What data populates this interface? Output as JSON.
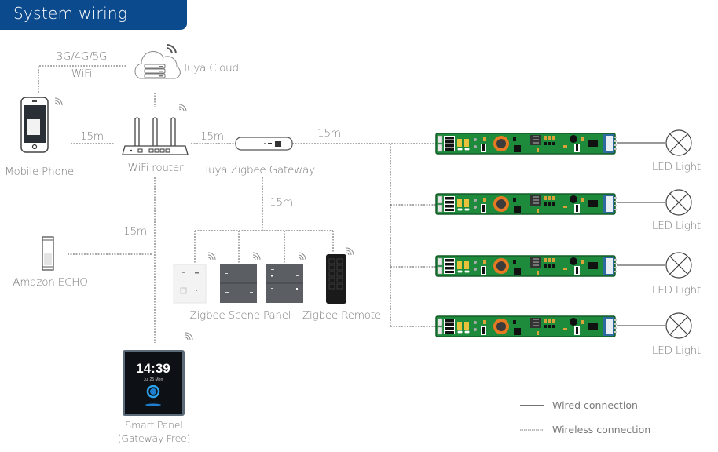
{
  "title": "System wiring",
  "colors": {
    "title_bg": "#0c4a8e",
    "title_text": "#ffffff",
    "label_text": "#7a7a7a",
    "line": "#555555",
    "pcb_green": "#1e8a3c",
    "pcb_blue": "#2d6a9f",
    "inductor": "#e67a22"
  },
  "nodes": {
    "cloud": {
      "label": "Tuya Cloud",
      "icon": "cloud-server-icon"
    },
    "mobile_phone": {
      "label": "Mobile Phone",
      "icon": "smartphone-icon"
    },
    "wifi_router": {
      "label": "WiFi router",
      "icon": "router-icon"
    },
    "gateway": {
      "label": "Tuya Zigbee Gateway",
      "icon": "zigbee-gateway-icon"
    },
    "amazon_echo": {
      "label": "Amazon ECHO",
      "icon": "smart-speaker-icon"
    },
    "scene_panel": {
      "label": "Zigbee Scene Panel",
      "icon": "scene-panel-icon"
    },
    "remote": {
      "label": "Zigbee Remote",
      "icon": "remote-icon"
    },
    "smart_panel": {
      "label_line1": "Smart Panel",
      "label_line2": "(Gateway Free)",
      "clock": "14:39",
      "date": "Jul 25 Mon",
      "icon": "smart-panel-icon"
    },
    "drivers": [
      {
        "label": "LED Light"
      },
      {
        "label": "LED Light"
      },
      {
        "label": "LED Light"
      },
      {
        "label": "LED Light"
      }
    ]
  },
  "links": {
    "phone_cloud_line1": "3G/4G/5G",
    "phone_cloud_line2": "WiFi",
    "phone_router": "15m",
    "router_gateway": "15m",
    "gateway_drivers": "15m",
    "gateway_panels": "15m",
    "router_echo": "15m"
  },
  "legend": {
    "wired": "Wired connection",
    "wireless": "Wireless connection"
  }
}
